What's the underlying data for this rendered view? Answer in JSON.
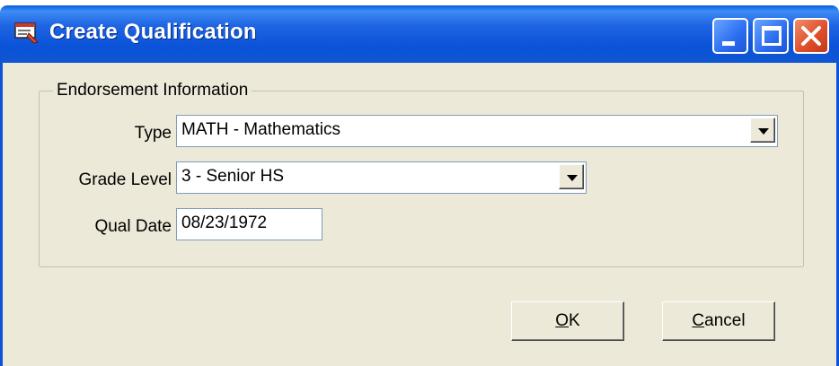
{
  "window": {
    "title": "Create Qualification",
    "icons": {
      "app": "form-icon",
      "minimize": "minimize-icon",
      "maximize": "maximize-icon",
      "close": "close-icon"
    }
  },
  "group": {
    "label": "Endorsement Information"
  },
  "fields": {
    "type": {
      "label": "Type",
      "value": "MATH - Mathematics"
    },
    "grade_level": {
      "label": "Grade Level",
      "value": "3 - Senior HS"
    },
    "qual_date": {
      "label": "Qual Date",
      "value": "08/23/1972"
    }
  },
  "buttons": {
    "ok": {
      "mnemonic": "O",
      "rest": "K"
    },
    "cancel": {
      "mnemonic": "C",
      "rest": "ancel"
    }
  },
  "colors": {
    "titlebar": "#0b53d8",
    "client": "#ece9d8",
    "close": "#e0502c"
  }
}
